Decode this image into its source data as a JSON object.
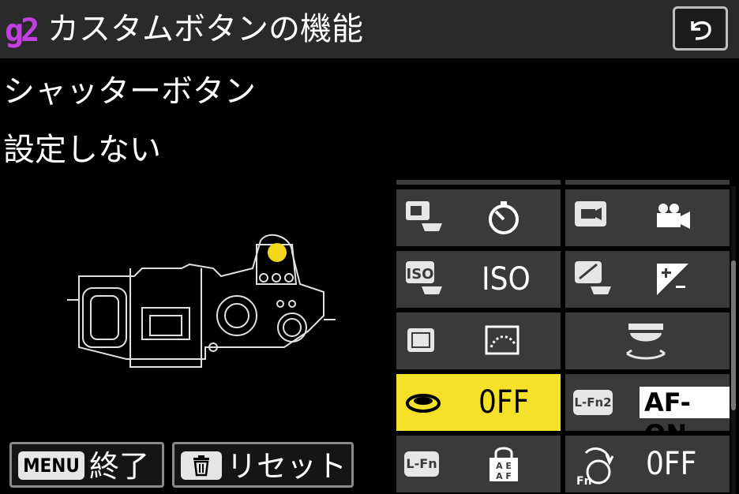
{
  "header": {
    "menu_tag": "g2",
    "title": "カスタムボタンの機能",
    "back_icon": "return-arrow-icon"
  },
  "selection": {
    "control_name": "シャッターボタン",
    "current_value": "設定しない"
  },
  "footer": {
    "exit": {
      "badge": "MENU",
      "label": "終了"
    },
    "reset": {
      "badge_icon": "trash-icon",
      "label": "リセット"
    }
  },
  "grid": {
    "rows": [
      [
        {
          "icon": "stack-camera-icon",
          "value_icon": "self-timer-icon"
        },
        {
          "icon": "movie-camera-badge-icon",
          "value_icon": "movie-camera-icon"
        }
      ],
      [
        {
          "icon": "iso-button-icon",
          "value": "ISO"
        },
        {
          "icon": "exposure-comp-button-icon",
          "value_icon": "exposure-comp-icon"
        }
      ],
      [
        {
          "icon": "picture-control-button-icon",
          "value_icon": "picture-control-icon"
        },
        {
          "icon": "",
          "value_icon": "command-dial-icon"
        }
      ],
      [
        {
          "icon": "shutter-release-icon",
          "value": "0FF",
          "selected": true
        },
        {
          "icon": "l-fn2-button-icon",
          "value": "AF-ON",
          "icon_label": "L-Fn2"
        }
      ],
      [
        {
          "icon": "l-fn-button-icon",
          "value_icon": "af-ae-lock-icon",
          "icon_label": "L-Fn"
        },
        {
          "icon": "fn-ring-icon",
          "value": "0FF",
          "icon_label": "Fn"
        }
      ]
    ]
  },
  "colors": {
    "accent": "#c040e0",
    "selected": "#f5e12a",
    "cell": "#3a3a3a",
    "header": "#2a2a2a"
  }
}
